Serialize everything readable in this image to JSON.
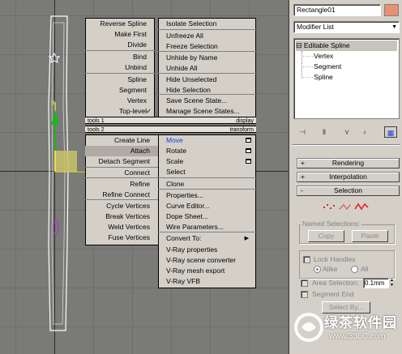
{
  "viewport": {
    "label": "3D viewport with selected spline"
  },
  "quad_menu": {
    "left_top": {
      "items": [
        "Reverse Spline",
        "Make First",
        "Divide",
        "Bind",
        "Unbind",
        "Spline",
        "Segment",
        "Vertex",
        "Top-level"
      ],
      "top_level_check": "✓",
      "header": "tools 1"
    },
    "left_bottom": {
      "header": "tools 2",
      "items": [
        "Create Line",
        "Attach",
        "Detach Segment",
        "Connect",
        "Refine",
        "Refine Connect",
        "Cycle Vertices",
        "Break Vertices",
        "Weld Vertices",
        "Fuse Vertices"
      ]
    },
    "right_top": {
      "items": [
        "Isolate Selection",
        "Unfreeze All",
        "Freeze Selection",
        "Unhide by Name",
        "Unhide All",
        "Hide Unselected",
        "Hide Selection",
        "Save Scene State...",
        "Manage Scene States..."
      ],
      "header": "display"
    },
    "right_bottom": {
      "header": "transform",
      "items": [
        "Move",
        "Rotate",
        "Scale",
        "Select",
        "Clone",
        "Properties...",
        "Curve Editor...",
        "Dope Sheet...",
        "Wire Parameters...",
        "Convert To:",
        "V-Ray properties",
        "V-Ray scene converter",
        "V-Ray mesh export",
        "V-Ray VFB"
      ],
      "submenu_arrow": "▶",
      "move_color": "#1d3fd6"
    }
  },
  "panel": {
    "object_name": "Rectangle01",
    "object_color": "#e89072",
    "modifier_list": "Modifier List",
    "stack": {
      "root": "Editable Spline",
      "expander": "⊟",
      "children": [
        "Vertex",
        "Segment",
        "Spline"
      ]
    },
    "toolbar_icons": [
      "pin-icon",
      "show-end-result-icon",
      "make-unique-icon",
      "remove-modifier-icon",
      "configure-sets-icon"
    ],
    "rollouts": [
      {
        "sign": "+",
        "label": "Rendering"
      },
      {
        "sign": "+",
        "label": "Interpolation"
      },
      {
        "sign": "-",
        "label": "Selection"
      }
    ],
    "named_selections": {
      "label": "Named Selections:",
      "copy": "Copy",
      "paste": "Paste"
    },
    "lock_handles": {
      "label": "Lock Handles",
      "alike": "Alike",
      "all": "All"
    },
    "area_selection": {
      "label": "Area Selection:",
      "value": "0.1mm"
    },
    "segment_end": "Segment End",
    "select_by": "Select By..."
  },
  "watermark": {
    "title": "绿茶软件园",
    "url": "www.33LC.com"
  }
}
